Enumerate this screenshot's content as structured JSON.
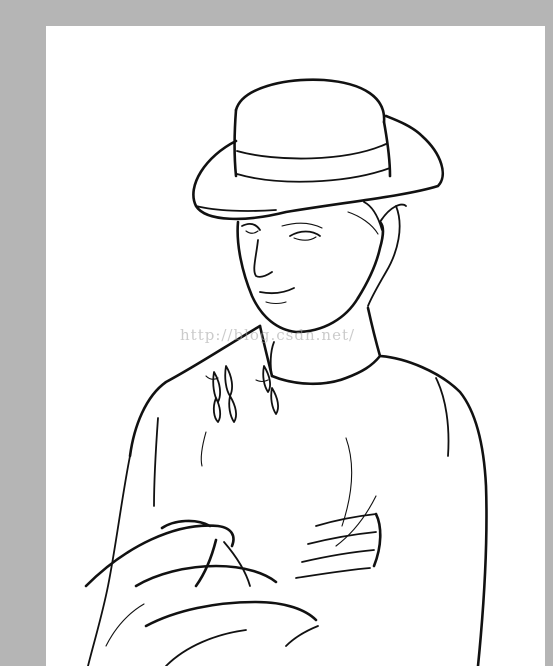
{
  "watermark": {
    "text": "http://blog.csdn.net/"
  },
  "canvas": {
    "background_color": "#ffffff",
    "workspace_color": "#b5b5b5"
  },
  "artwork": {
    "icon": "line-art-sketch"
  }
}
